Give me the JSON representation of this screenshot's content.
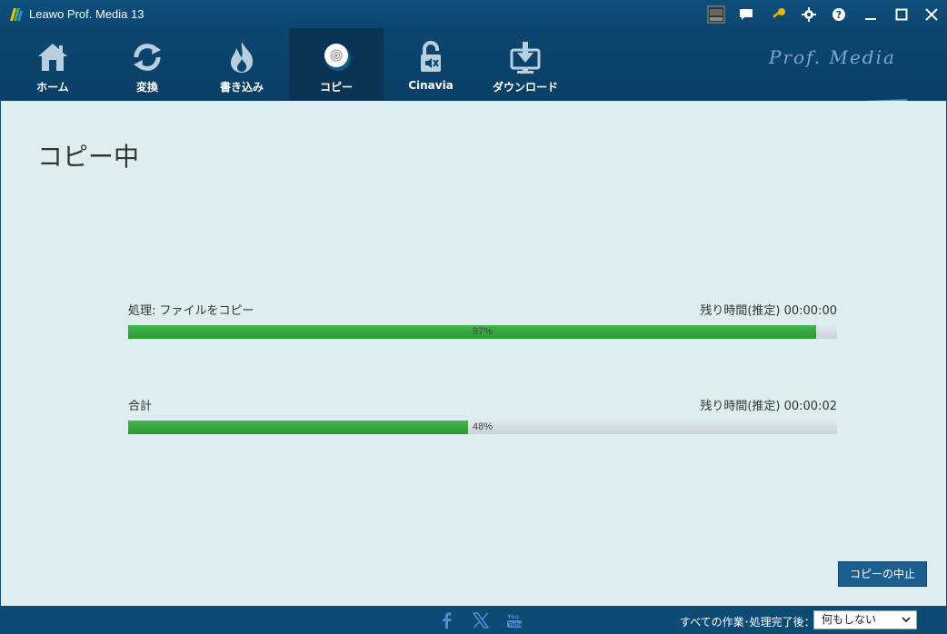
{
  "window": {
    "title": "Leawo Prof. Media 13"
  },
  "nav": {
    "tabs": [
      {
        "label": "ホーム",
        "icon": "home-icon"
      },
      {
        "label": "変換",
        "icon": "convert-icon"
      },
      {
        "label": "書き込み",
        "icon": "burn-icon"
      },
      {
        "label": "コピー",
        "icon": "copy-disc-icon",
        "active": true
      },
      {
        "label": "Cinavia",
        "icon": "cinavia-icon"
      },
      {
        "label": "ダウンロード",
        "icon": "download-icon"
      }
    ],
    "brand": "Prof. Media"
  },
  "main": {
    "title": "コピー中",
    "progress": [
      {
        "label": "処理: ファイルをコピー",
        "remaining": "残り時間(推定) 00:00:00",
        "percent_text": "97%",
        "percent": 97
      },
      {
        "label": "合計",
        "remaining": "残り時間(推定) 00:00:02",
        "percent_text": "48%",
        "percent": 48
      }
    ],
    "stop_button": "コピーの中止"
  },
  "footer": {
    "after_label": "すべての作業･処理完了後：",
    "after_value": "何もしない"
  },
  "colors": {
    "accent": "#0d4a74",
    "progress": "#3aa840",
    "background": "#dceeef"
  }
}
